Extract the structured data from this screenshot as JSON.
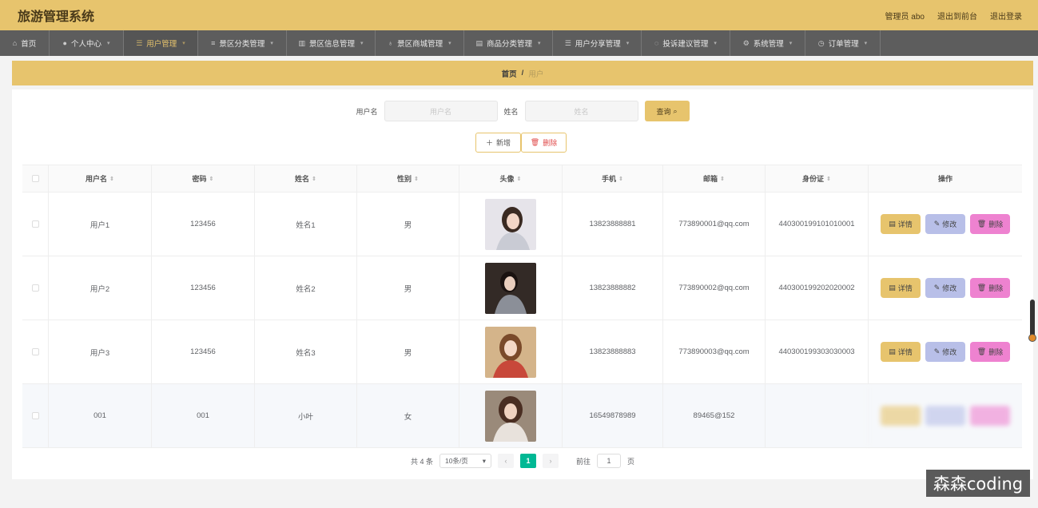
{
  "header": {
    "title": "旅游管理系统",
    "admin_label": "管理员 abo",
    "front_label": "退出到前台",
    "logout_label": "退出登录"
  },
  "nav": {
    "items": [
      {
        "label": "首页",
        "icon": "home-icon"
      },
      {
        "label": "个人中心",
        "icon": "user-icon"
      },
      {
        "label": "用户管理",
        "icon": "list-icon"
      },
      {
        "label": "景区分类管理",
        "icon": "sliders-icon"
      },
      {
        "label": "景区信息管理",
        "icon": "chart-icon"
      },
      {
        "label": "景区商城管理",
        "icon": "mic-icon"
      },
      {
        "label": "商品分类管理",
        "icon": "doc-icon"
      },
      {
        "label": "用户分享管理",
        "icon": "menu-icon"
      },
      {
        "label": "投诉建议管理",
        "icon": "power-icon"
      },
      {
        "label": "系统管理",
        "icon": "gear-icon"
      },
      {
        "label": "订单管理",
        "icon": "clock-icon"
      }
    ]
  },
  "breadcrumb": {
    "home": "首页",
    "sep": "/",
    "current": "用户"
  },
  "search": {
    "username_label": "用户名",
    "username_placeholder": "用户名",
    "name_label": "姓名",
    "name_placeholder": "姓名",
    "query_label": "查询"
  },
  "actions": {
    "add_label": "新增",
    "delete_label": "删除"
  },
  "table": {
    "headers": [
      "用户名",
      "密码",
      "姓名",
      "性别",
      "头像",
      "手机",
      "邮箱",
      "身份证",
      "操作"
    ],
    "rows": [
      {
        "username": "用户1",
        "password": "123456",
        "name": "姓名1",
        "gender": "男",
        "phone": "13823888881",
        "email": "773890001@qq.com",
        "idcard": "440300199101010001"
      },
      {
        "username": "用户2",
        "password": "123456",
        "name": "姓名2",
        "gender": "男",
        "phone": "13823888882",
        "email": "773890002@qq.com",
        "idcard": "440300199202020002"
      },
      {
        "username": "用户3",
        "password": "123456",
        "name": "姓名3",
        "gender": "男",
        "phone": "13823888883",
        "email": "773890003@qq.com",
        "idcard": "440300199303030003"
      },
      {
        "username": "001",
        "password": "001",
        "name": "小叶",
        "gender": "女",
        "phone": "16549878989",
        "email": "89465@152",
        "idcard": ""
      }
    ],
    "op_detail": "详情",
    "op_edit": "修改",
    "op_remove": "删除"
  },
  "pager": {
    "total_label": "共 4 条",
    "page_size": "10条/页",
    "current_page": "1",
    "goto_label": "前往",
    "goto_value": "1",
    "page_suffix": "页"
  },
  "watermark": "森森coding"
}
